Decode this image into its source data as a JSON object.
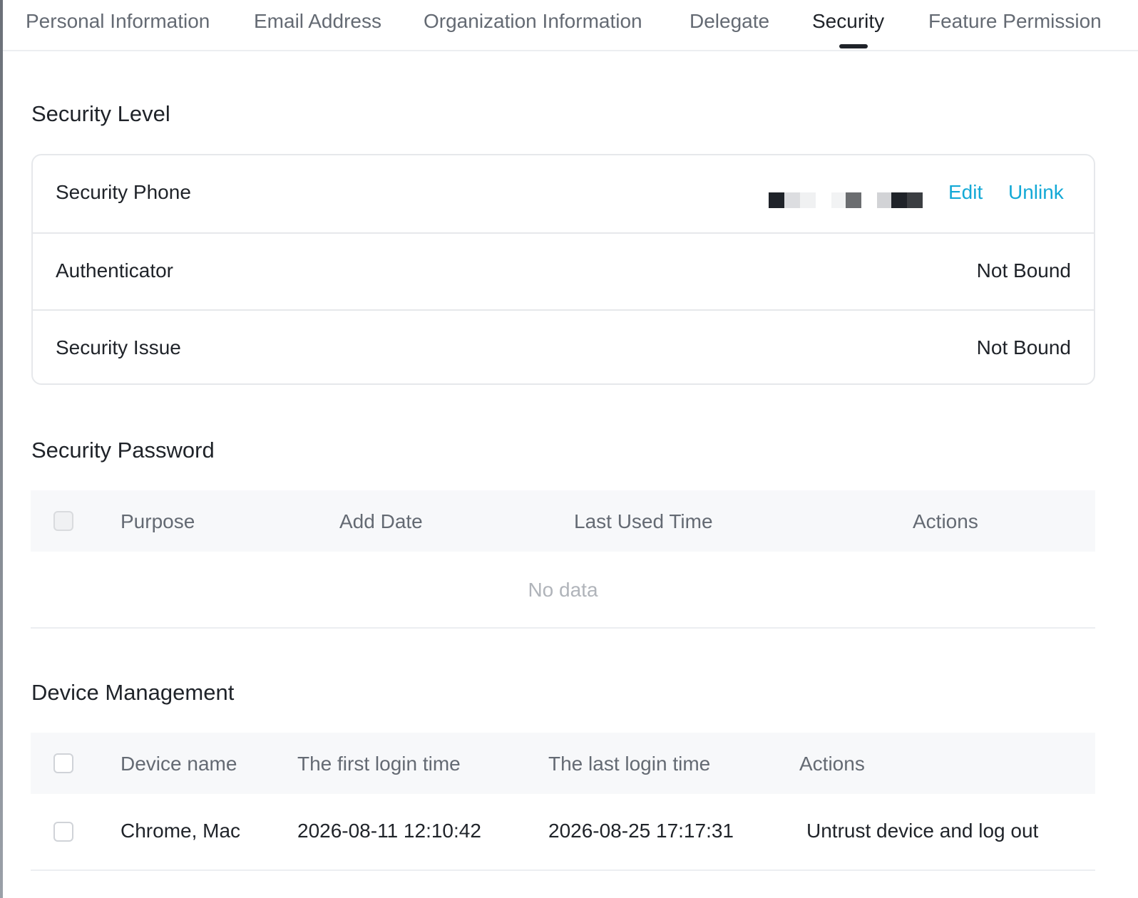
{
  "tabs": [
    {
      "label": "Personal Information"
    },
    {
      "label": "Email Address"
    },
    {
      "label": "Organization Information"
    },
    {
      "label": "Delegate"
    },
    {
      "label": "Security"
    },
    {
      "label": "Feature Permission"
    }
  ],
  "active_tab": "Security",
  "security_level": {
    "title": "Security Level",
    "rows": [
      {
        "label": "Security Phone",
        "edit_label": "Edit",
        "unlink_label": "Unlink"
      },
      {
        "label": "Authenticator",
        "value": "Not Bound"
      },
      {
        "label": "Security Issue",
        "value": "Not Bound"
      }
    ]
  },
  "security_password": {
    "title": "Security Password",
    "columns": [
      "Purpose",
      "Add Date",
      "Last Used Time",
      "Actions"
    ],
    "empty_text": "No data"
  },
  "device_management": {
    "title": "Device Management",
    "columns": [
      "Device name",
      "The first login time",
      "The last login time",
      "Actions"
    ],
    "rows": [
      {
        "device_name": "Chrome, Mac",
        "first_login": "2026-08-11 12:10:42",
        "last_login": "2026-08-25 17:17:31",
        "action": "Untrust device and log out"
      }
    ]
  },
  "colors": {
    "accent_link": "#14a9d6",
    "active_tab": "#1f2329",
    "inactive_tab": "#646a73"
  }
}
